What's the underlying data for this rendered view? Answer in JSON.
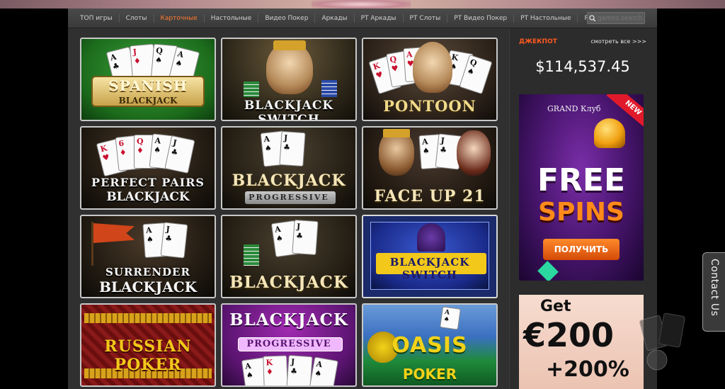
{
  "nav": {
    "items": [
      {
        "label": "ТОП игры",
        "active": false
      },
      {
        "label": "Слоты",
        "active": false
      },
      {
        "label": "Карточные",
        "active": true
      },
      {
        "label": "Настольные",
        "active": false
      },
      {
        "label": "Видео Покер",
        "active": false
      },
      {
        "label": "Аркады",
        "active": false
      },
      {
        "label": "РТ Аркады",
        "active": false
      },
      {
        "label": "РТ Слоты",
        "active": false
      },
      {
        "label": "РТ Видео Покер",
        "active": false
      },
      {
        "label": "РТ Настольные",
        "active": false
      },
      {
        "label": "РТ Карточные",
        "active": false
      }
    ],
    "search_placeholder": "games.search"
  },
  "games": [
    {
      "title": "SPANISH",
      "subtitle": "BLACKJACK"
    },
    {
      "title": "BLACKJACK SWITCH",
      "subtitle": ""
    },
    {
      "title": "PONTOON",
      "subtitle": ""
    },
    {
      "title": "PERFECT PAIRS",
      "subtitle": "BLACKJACK"
    },
    {
      "title": "BLACKJACK",
      "subtitle": "PROGRESSIVE"
    },
    {
      "title": "FACE UP 21",
      "subtitle": ""
    },
    {
      "title": "SURRENDER",
      "subtitle": "BLACKJACK"
    },
    {
      "title": "BLACKJACK",
      "subtitle": ""
    },
    {
      "title": "BLACKJACK SWITCH",
      "subtitle": ""
    },
    {
      "title": "RUSSIAN POKER",
      "subtitle": ""
    },
    {
      "title": "BLACKJACK",
      "subtitle": "PROGRESSIVE"
    },
    {
      "title": "OASIS",
      "subtitle": "POKER"
    }
  ],
  "jackpot": {
    "label": "ДЖЕКПОТ",
    "link": "смотреть все >>>",
    "value": "$114,537.45"
  },
  "promo1": {
    "brand": "GRAND Клуб",
    "badge": "NEW",
    "line1": "FREE",
    "line2": "SPINS",
    "button": "ПОЛУЧИТЬ"
  },
  "promo2": {
    "line1": "Get",
    "line2": "€200",
    "line3": "+200%"
  },
  "contact": {
    "label": "Contact Us"
  }
}
